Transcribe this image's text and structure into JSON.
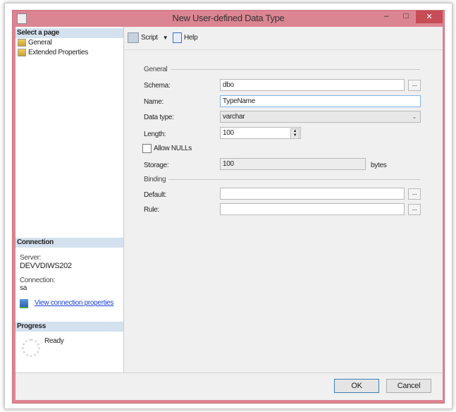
{
  "window": {
    "title": "New User-defined Data Type",
    "minimize": "–",
    "maximize": "□",
    "close": "✕"
  },
  "sidebar": {
    "header": "Select a page",
    "pages": [
      {
        "label": "General"
      },
      {
        "label": "Extended Properties"
      }
    ],
    "connection": {
      "header": "Connection",
      "server_label": "Server:",
      "server": "DEVVDIWS202",
      "connection_label": "Connection:",
      "connection": "sa",
      "link": "View connection properties"
    },
    "progress": {
      "header": "Progress",
      "status": "Ready"
    }
  },
  "toolbar": {
    "script": "Script",
    "help": "Help"
  },
  "form": {
    "general_section": "General",
    "schema_label": "Schema:",
    "schema": "dbo",
    "name_label": "Name:",
    "name": "TypeName",
    "datatype_label": "Data type:",
    "datatype": "varchar",
    "length_label": "Length:",
    "length": "100",
    "allow_nulls": "Allow NULLs",
    "allow_nulls_checked": false,
    "storage_label": "Storage:",
    "storage": "100",
    "storage_unit": "bytes",
    "binding_section": "Binding",
    "default_label": "Default:",
    "default": "",
    "rule_label": "Rule:",
    "rule": "",
    "browse": "..."
  },
  "buttons": {
    "ok": "OK",
    "cancel": "Cancel"
  }
}
